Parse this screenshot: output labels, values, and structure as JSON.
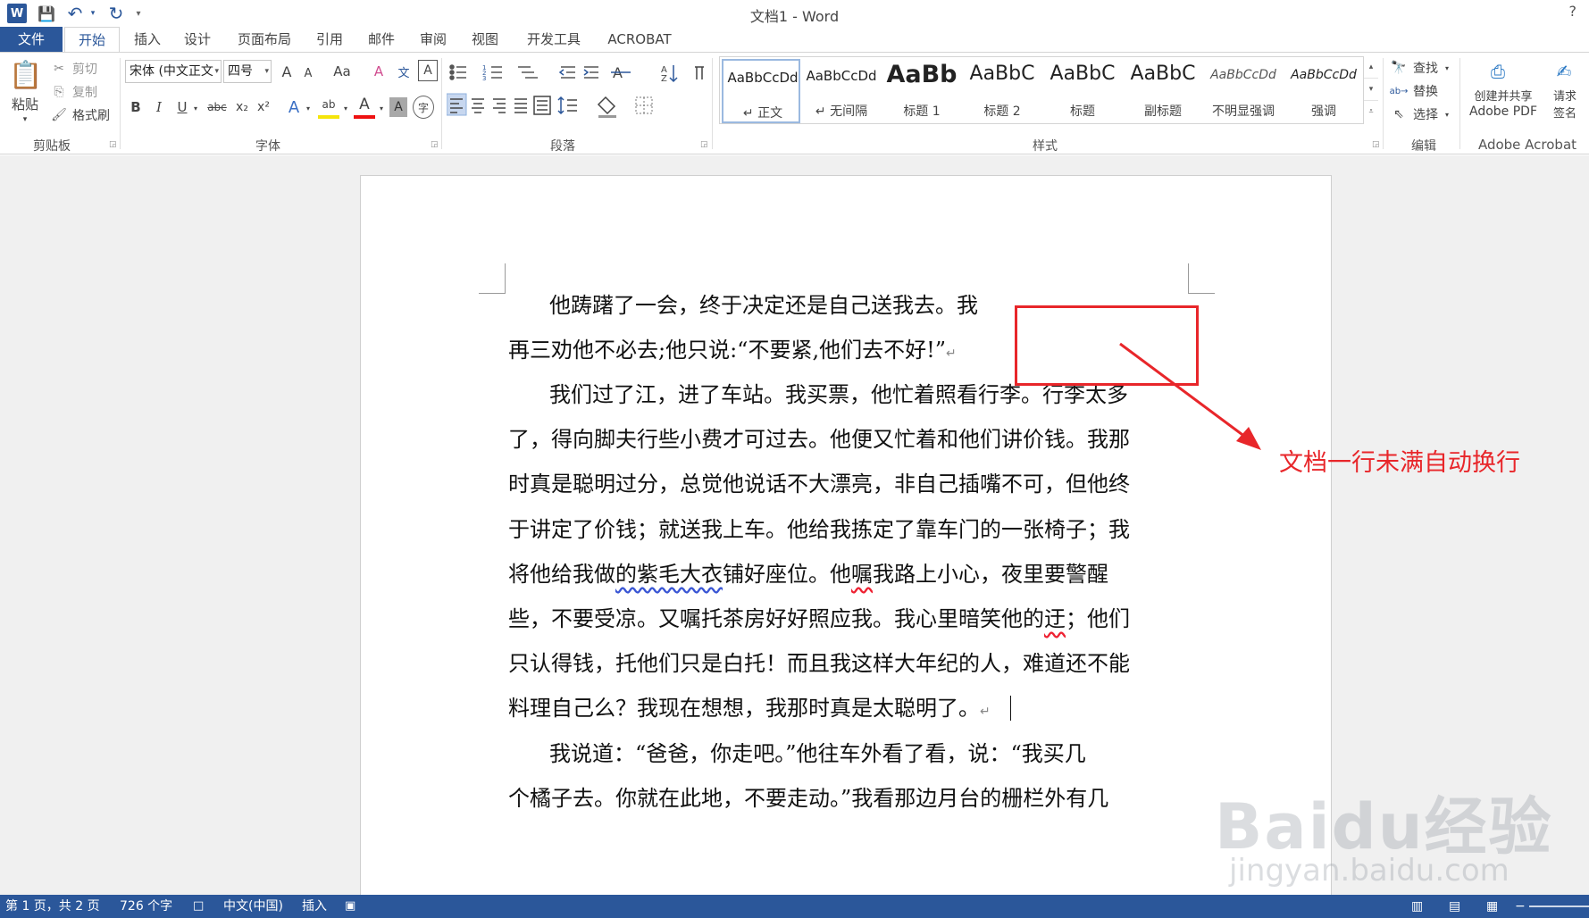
{
  "window": {
    "title": "文档1 - Word",
    "help": "?"
  },
  "qat": {
    "logo": "W",
    "save": "💾",
    "undo": "↶",
    "redo": "↻",
    "customize": "▾"
  },
  "tabs": [
    "文件",
    "开始",
    "插入",
    "设计",
    "页面布局",
    "引用",
    "邮件",
    "审阅",
    "视图",
    "开发工具",
    "ACROBAT"
  ],
  "clipboard": {
    "paste": "粘贴",
    "cut": "剪切",
    "copy": "复制",
    "format_painter": "格式刷",
    "label": "剪贴板"
  },
  "font": {
    "family": "宋体 (中文正文",
    "size": "四号",
    "label": "字体",
    "grow": "A",
    "shrink": "A",
    "case": "Aa",
    "clear": "A",
    "phonetic": "文",
    "border": "A",
    "bold": "B",
    "italic": "I",
    "underline": "U",
    "strike": "abc",
    "subscript": "x₂",
    "superscript": "x²",
    "effects": "A",
    "highlight": "ab",
    "color": "A",
    "shading": "A",
    "enclose": "字"
  },
  "paragraph": {
    "label": "段落"
  },
  "styles": {
    "label": "样式",
    "items": [
      {
        "preview": "AaBbCcDd",
        "name": "↵ 正文"
      },
      {
        "preview": "AaBbCcDd",
        "name": "↵ 无间隔"
      },
      {
        "preview": "AaBb",
        "name": "标题 1"
      },
      {
        "preview": "AaBbC",
        "name": "标题 2"
      },
      {
        "preview": "AaBbC",
        "name": "标题"
      },
      {
        "preview": "AaBbC",
        "name": "副标题"
      },
      {
        "preview": "AaBbCcDd",
        "name": "不明显强调"
      },
      {
        "preview": "AaBbCcDd",
        "name": "强调"
      }
    ]
  },
  "editing": {
    "find": "查找",
    "replace": "替换",
    "select": "选择",
    "label": "编辑"
  },
  "acrobat": {
    "create_line1": "创建并共享",
    "create_line2": "Adobe PDF",
    "sign_line1": "请求",
    "sign_line2": "签名",
    "label": "Adobe Acrobat"
  },
  "document": {
    "lines": [
      {
        "segments": [
          {
            "t": "他踌躇了一会，终于决定还是自己送我去。我"
          }
        ]
      },
      {
        "segments": [
          {
            "t": "再三劝他不必去;他只说:“不要紧,他们去不好!”"
          }
        ],
        "mark": "↵"
      },
      {
        "segments": [
          {
            "t": "我们过了江，进了车站。我买票，他忙着照看行李。行李太多"
          }
        ]
      },
      {
        "segments": [
          {
            "t": "了，得向脚夫行些小费才可过去。他便又忙着和他们讲价钱。我那"
          }
        ]
      },
      {
        "segments": [
          {
            "t": "时真是聪明过分，总觉他说话不大漂亮，非自己插嘴不可，但他终"
          }
        ]
      },
      {
        "segments": [
          {
            "t": "于讲定了价钱；就送我上车。他给我拣定了靠车门的一张椅子；我"
          }
        ]
      },
      {
        "segments": [
          {
            "t": "将他给我做"
          },
          {
            "t": "的紫毛大衣",
            "u": "blue"
          },
          {
            "t": "铺好座位。他"
          },
          {
            "t": "嘱",
            "u": "red"
          },
          {
            "t": "我路上小心，夜里要警醒"
          }
        ]
      },
      {
        "segments": [
          {
            "t": "些，不要受凉。又嘱托茶房好好照应我。我心里暗笑他的"
          },
          {
            "t": "迂",
            "u": "red"
          },
          {
            "t": "；他们"
          }
        ]
      },
      {
        "segments": [
          {
            "t": "只认得钱，托他们只是白托！而且我这样大年纪的人，难道还不能"
          }
        ]
      },
      {
        "segments": [
          {
            "t": "料理自己么？我现在想想，我那时真是太聪明了。"
          }
        ],
        "mark": "↵"
      },
      {
        "segments": [
          {
            "t": "我说道：“爸爸，你走吧。”他往车外看了看，说：“我买几"
          }
        ]
      },
      {
        "segments": [
          {
            "t": "个橘子去。你就在此地，不要走动。”我看那边月台的栅栏外有几"
          }
        ]
      }
    ]
  },
  "annotation": {
    "text": "文档一行未满自动换行",
    "color": "#e8262a"
  },
  "watermark": {
    "text": "Baidu经验",
    "sub": "jingyan.baidu.com"
  },
  "status": {
    "page": "第 1 页，共 2 页",
    "words": "726 个字",
    "proof": "□",
    "language": "中文(中国)",
    "mode": "插入",
    "macro": "▣"
  },
  "colors": {
    "accent": "#2b579a",
    "annotation": "#e8262a"
  }
}
